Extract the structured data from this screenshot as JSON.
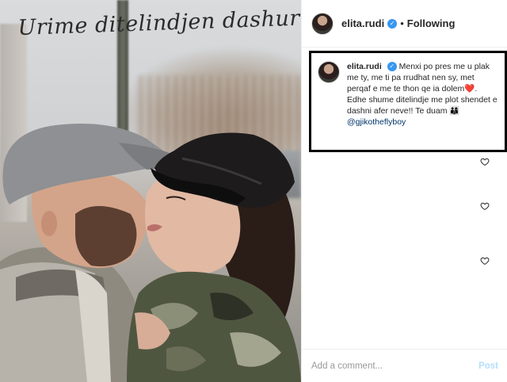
{
  "photo": {
    "overlay_text": "Urime ditelindjen dashuri!"
  },
  "post": {
    "username": "elita.rudi",
    "verified_icon": "verified-badge-icon",
    "separator": "•",
    "follow_status": "Following",
    "caption_text": "Menxi po pres me u plak me ty, me ti pa rrudhat nen sy, met perqaf e me te thon qe ia dolem❤️. Edhe shume ditelindje me plot shendet e dashni afer neve!! Te duam 👨‍👩‍👦 ",
    "mention": "@gjikotheflyboy"
  },
  "comment_box": {
    "placeholder": "Add a comment...",
    "post_label": "Post"
  },
  "colors": {
    "verified": "#3897f0",
    "mention": "#003569",
    "post_disabled": "#b2dffc",
    "highlight_border": "#000000"
  }
}
